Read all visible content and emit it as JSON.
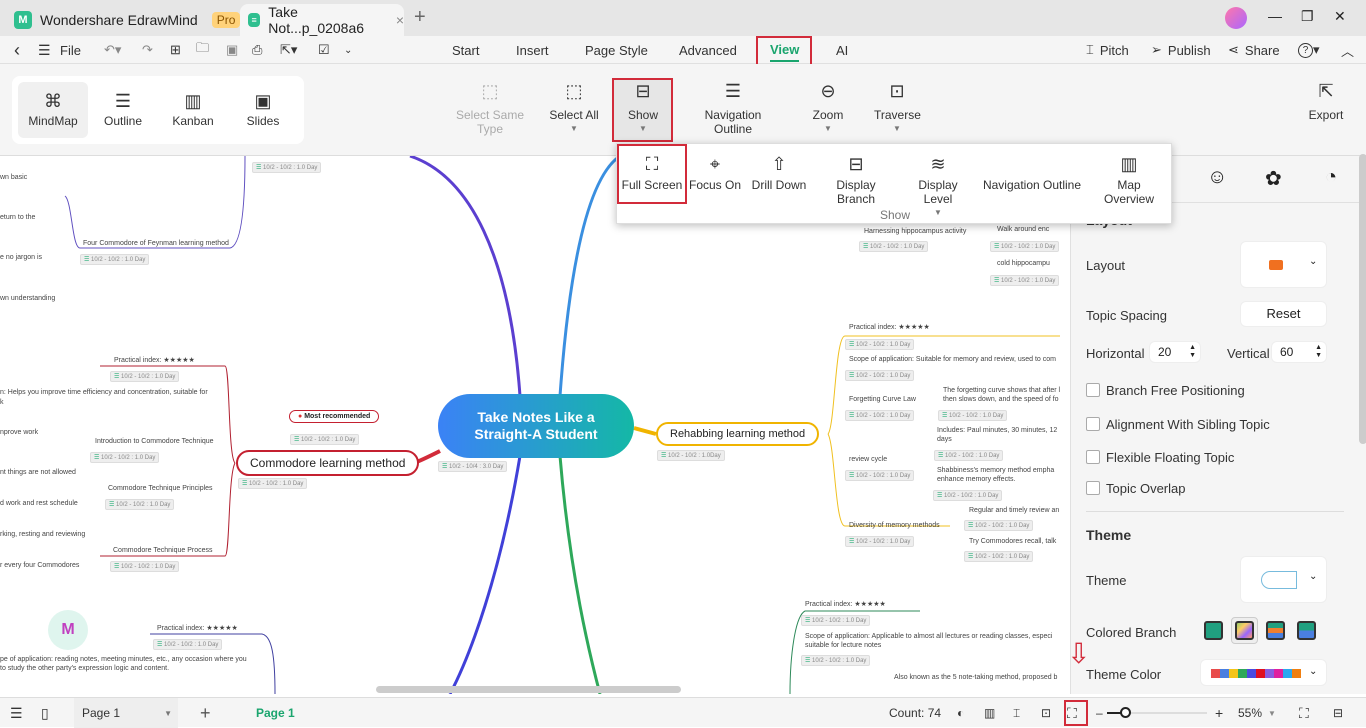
{
  "titlebar": {
    "app_name": "Wondershare EdrawMind",
    "badge": "Pro",
    "doc_tab": "Take Not...p_0208a6",
    "close": "×",
    "new_tab": "+"
  },
  "window": {
    "minimize": "—",
    "restore": "❐",
    "close": "✕"
  },
  "menubar": {
    "back": "‹",
    "menu": "☰",
    "file": "File",
    "tabs": [
      "Start",
      "Insert",
      "Page Style",
      "Advanced",
      "View",
      "AI"
    ],
    "active_tab": "View",
    "right": {
      "pitch": "Pitch",
      "publish": "Publish",
      "share": "Share",
      "help": "?"
    }
  },
  "ribbon": {
    "views": [
      {
        "label": "MindMap",
        "icon": "⌘"
      },
      {
        "label": "Outline",
        "icon": "☰"
      },
      {
        "label": "Kanban",
        "icon": "▥"
      },
      {
        "label": "Slides",
        "icon": "▣"
      }
    ],
    "buttons": {
      "select_same_type": "Select Same Type",
      "select_all": "Select All",
      "show": "Show",
      "navigation_outline": "Navigation Outline",
      "zoom": "Zoom",
      "traverse": "Traverse",
      "export": "Export"
    }
  },
  "show_popup": {
    "items": [
      {
        "label": "Full Screen",
        "icon": "⛶",
        "enabled": true
      },
      {
        "label": "Focus On",
        "icon": "⌖",
        "enabled": false
      },
      {
        "label": "Drill Down",
        "icon": "⇧",
        "enabled": false
      },
      {
        "label": "Display Branch",
        "icon": "⊟",
        "enabled": true
      },
      {
        "label": "Display Level",
        "icon": "≋",
        "enabled": true
      },
      {
        "label": "Navigation Outline",
        "icon": "",
        "enabled": true
      },
      {
        "label": "Map Overview",
        "icon": "▥",
        "enabled": true
      }
    ],
    "group_label": "Show"
  },
  "mindmap": {
    "central": "Take Notes Like a Straight-A Student",
    "central_tag": "10/2 - 10/4 : 3.0 Day",
    "commodore": {
      "title": "Commodore learning method",
      "tag": "10/2 - 10/2 : 1.0 Day",
      "callout": "Most recommended",
      "callout_tag": "10/2 - 10/2 : 1.0 Day",
      "children": [
        "Practical index: ★★★★★",
        "n: Helps you improve time efficiency and concentration, suitable for",
        "k",
        "nprove work",
        "Introduction to Commodore Technique",
        "nt things are not allowed",
        "Commodore Technique Principles",
        "d work and rest schedule",
        "rking, resting and reviewing",
        "Commodore Technique Process",
        "r every four Commodores"
      ]
    },
    "feynman": {
      "title": "Four Commodore of Feynman learning method",
      "tag": "10/2 - 10/2 : 1.0 Day",
      "leaves": [
        "wn basic",
        "eturn to the",
        "e no jargon is",
        "wn understanding"
      ]
    },
    "rehab": {
      "title": "Rehabbing learning method",
      "tag": "10/2 - 10/2 : 1.0Day",
      "children": [
        "Practical index: ★★★★★",
        "Scope of application: Suitable for memory and review, used to com",
        "Forgetting Curve Law",
        "The forgetting curve shows that after l",
        "then slows down, and the speed of fo",
        "Includes: Paul minutes, 30 minutes, 12",
        "days",
        "review cycle",
        "Shabbiness's memory method empha",
        "enhance memory effects.",
        "Diversity of memory methods",
        "Regular and timely review an",
        "Try Commodores recall, talk"
      ]
    },
    "hippo": {
      "title": "Harnessing hippocampus activity",
      "leaf1": "Walk around enc",
      "leaf2": "cold hippocampu"
    },
    "bottom_left": {
      "index": "Practical index: ★★★★★",
      "scope1": "pe of application: reading notes, meeting minutes, etc., any occasion where you",
      "scope2": "to study the other party's expression logic and content."
    },
    "bottom_right": {
      "index": "Practical index: ★★★★★",
      "scope1": "Scope of application: Applicable to almost all lectures or reading classes, especi",
      "scope2": "suitable for lecture notes",
      "also": "Also known as the 5 note-taking method, proposed b"
    },
    "tag": "10/2 - 10/2 : 1.0 Day"
  },
  "panel": {
    "layout_heading": "Layout",
    "layout": "Layout",
    "topic_spacing": "Topic Spacing",
    "reset": "Reset",
    "horizontal": "Horizontal",
    "horizontal_value": "20",
    "vertical": "Vertical",
    "vertical_value": "60",
    "checkboxes": [
      "Branch Free Positioning",
      "Alignment With Sibling Topic",
      "Flexible Floating Topic",
      "Topic Overlap"
    ],
    "theme_heading": "Theme",
    "theme": "Theme",
    "colored_branch": "Colored Branch",
    "theme_color": "Theme Color",
    "theme_colors": [
      "#e84c4c",
      "#4a7fe0",
      "#f5c518",
      "#2ea85a",
      "#4b4be0",
      "#e01020",
      "#8a5ce0",
      "#e020a0",
      "#2aa8f0",
      "#f07f10"
    ]
  },
  "statusbar": {
    "page_select": "Page 1",
    "add": "+",
    "page_tab": "Page 1",
    "count": "Count: 74",
    "zoom_minus": "–",
    "zoom_plus": "+",
    "zoom_level": "55%",
    "zoom_fraction": 0.18
  }
}
